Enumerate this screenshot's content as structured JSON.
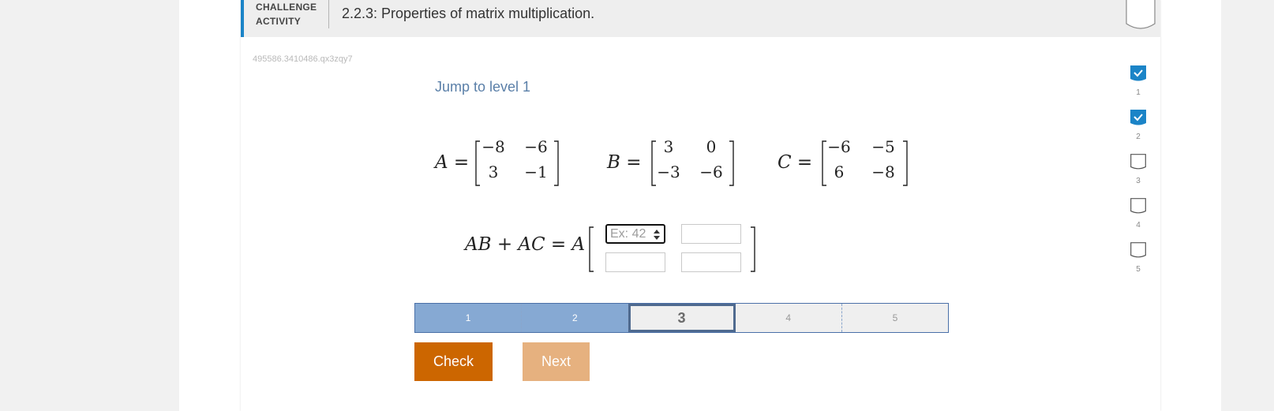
{
  "header": {
    "label_line1": "CHALLENGE",
    "label_line2": "ACTIVITY",
    "title": "2.2.3: Properties of matrix multiplication."
  },
  "activity_id": "495586.3410486.qx3zqy7",
  "jump_link": "Jump to level 1",
  "matrices": {
    "A": {
      "name": "A =",
      "cells": [
        "−8",
        "−6",
        "3",
        "−1"
      ]
    },
    "B": {
      "name": "B =",
      "cells": [
        "3",
        "0",
        "−3",
        "−6"
      ]
    },
    "C": {
      "name": "C =",
      "cells": [
        "−6",
        "−5",
        "6",
        "−8"
      ]
    }
  },
  "equation": {
    "lhs": "AB + AC = A",
    "inputs": [
      {
        "placeholder": "Ex: 42",
        "value": ""
      },
      {
        "placeholder": "",
        "value": ""
      },
      {
        "placeholder": "",
        "value": ""
      },
      {
        "placeholder": "",
        "value": ""
      }
    ]
  },
  "progress": {
    "segments": [
      "1",
      "2",
      "3",
      "4",
      "5"
    ],
    "completed": 2,
    "current": 3
  },
  "buttons": {
    "check": "Check",
    "next": "Next"
  },
  "levels": [
    {
      "num": "1",
      "done": true
    },
    {
      "num": "2",
      "done": true
    },
    {
      "num": "3",
      "done": false
    },
    {
      "num": "4",
      "done": false
    },
    {
      "num": "5",
      "done": false
    }
  ],
  "colors": {
    "accent": "#1b84c7",
    "check_button": "#cc6600",
    "next_button": "#e6b17f",
    "progress_done": "#86a9d3",
    "link": "#5a7fa8"
  }
}
